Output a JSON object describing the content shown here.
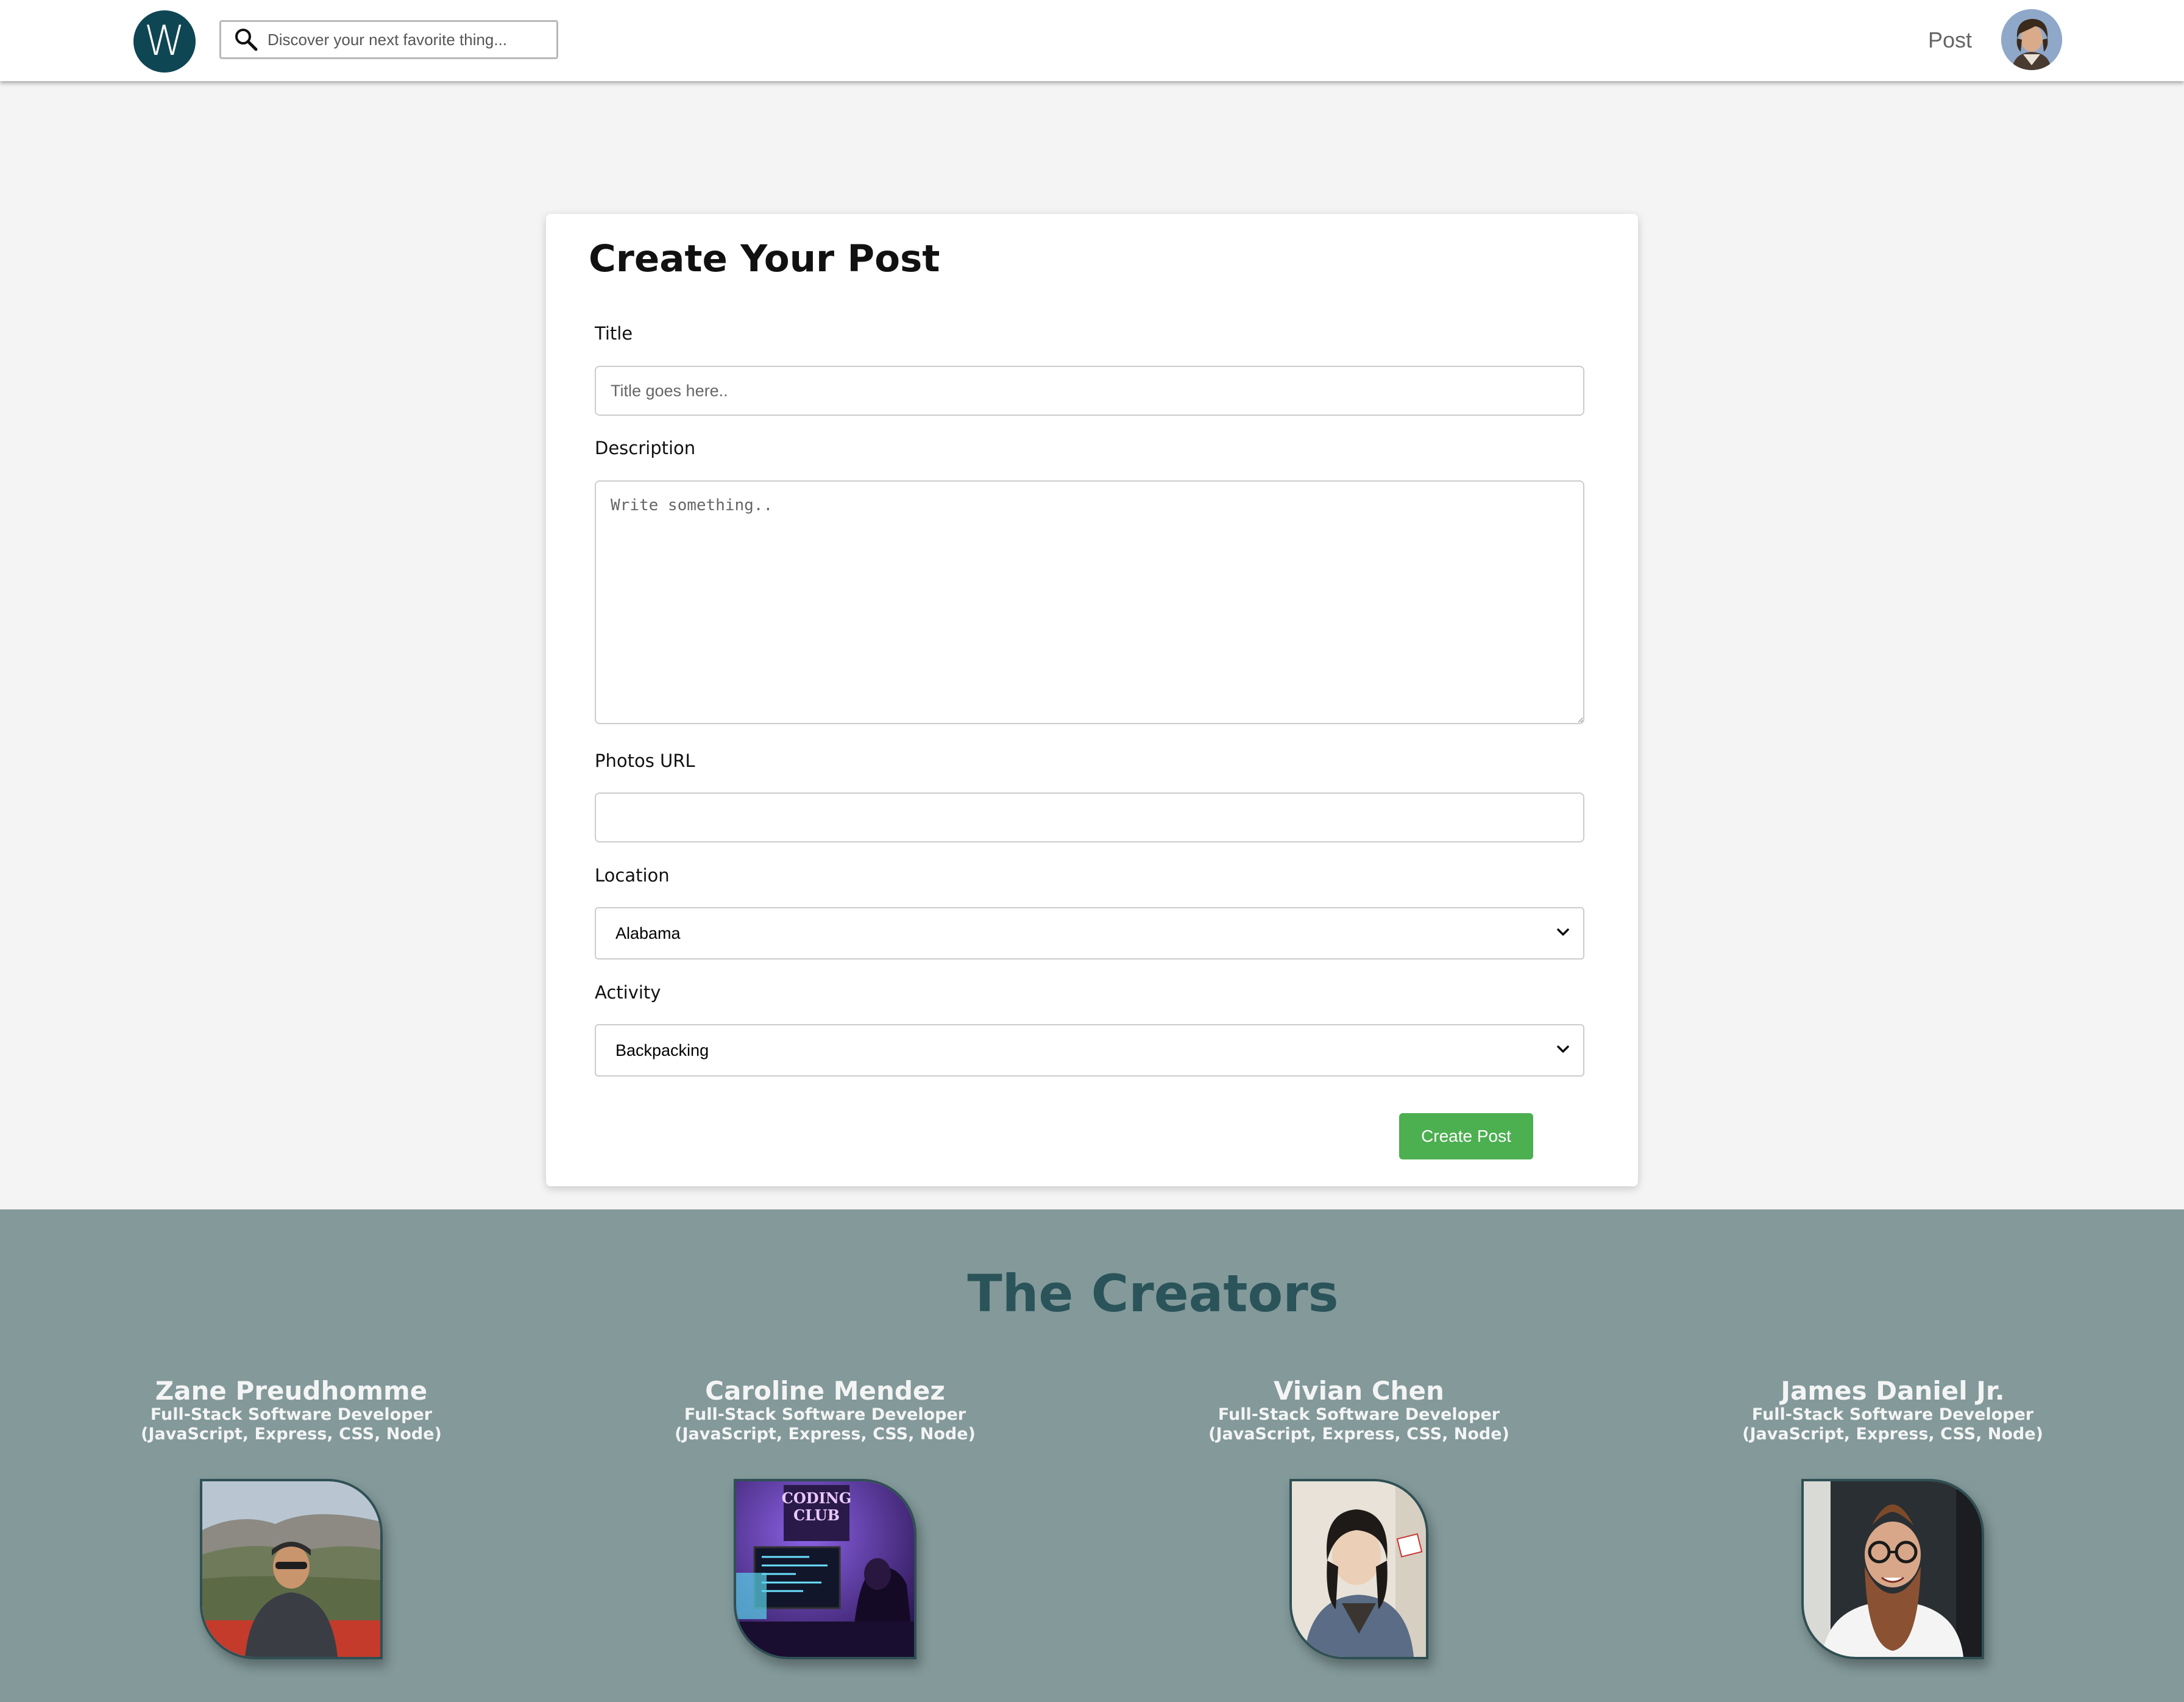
{
  "navbar": {
    "logo_letter": "W",
    "search": {
      "placeholder": "Discover your next favorite thing..."
    },
    "post_link": "Post",
    "avatar_alt": "User avatar"
  },
  "form": {
    "title": "Create Your Post",
    "fields": {
      "title": {
        "label": "Title",
        "placeholder": "Title goes here.."
      },
      "description": {
        "label": "Description",
        "placeholder": "Write something.."
      },
      "photos_url": {
        "label": "Photos URL",
        "placeholder": ""
      },
      "location": {
        "label": "Location",
        "value": "Alabama"
      },
      "activity": {
        "label": "Activity",
        "value": "Backpacking"
      }
    },
    "submit_label": "Create Post"
  },
  "creators": {
    "heading": "The Creators",
    "people": [
      {
        "name": "Zane Preudhomme",
        "role": "Full-Stack Software Developer",
        "stack": "(JavaScript, Express, CSS, Node)"
      },
      {
        "name": "Caroline Mendez",
        "role": "Full-Stack Software Developer",
        "stack": "(JavaScript, Express, CSS, Node)",
        "photo_sign": "CODING\nCLUB",
        "photo_sign_line1": "CODING",
        "photo_sign_line2": "CLUB"
      },
      {
        "name": "Vivian Chen",
        "role": "Full-Stack Software Developer",
        "stack": "(JavaScript, Express, CSS, Node)"
      },
      {
        "name": "James Daniel Jr.",
        "role": "Full-Stack Software Developer",
        "stack": "(JavaScript, Express, CSS, Node)"
      }
    ]
  },
  "colors": {
    "logo_bg": "#0f4654",
    "page_bg": "#f4f4f4",
    "creators_bg": "#83999a",
    "creators_heading": "#2a5459",
    "submit_button": "#4caf50"
  }
}
